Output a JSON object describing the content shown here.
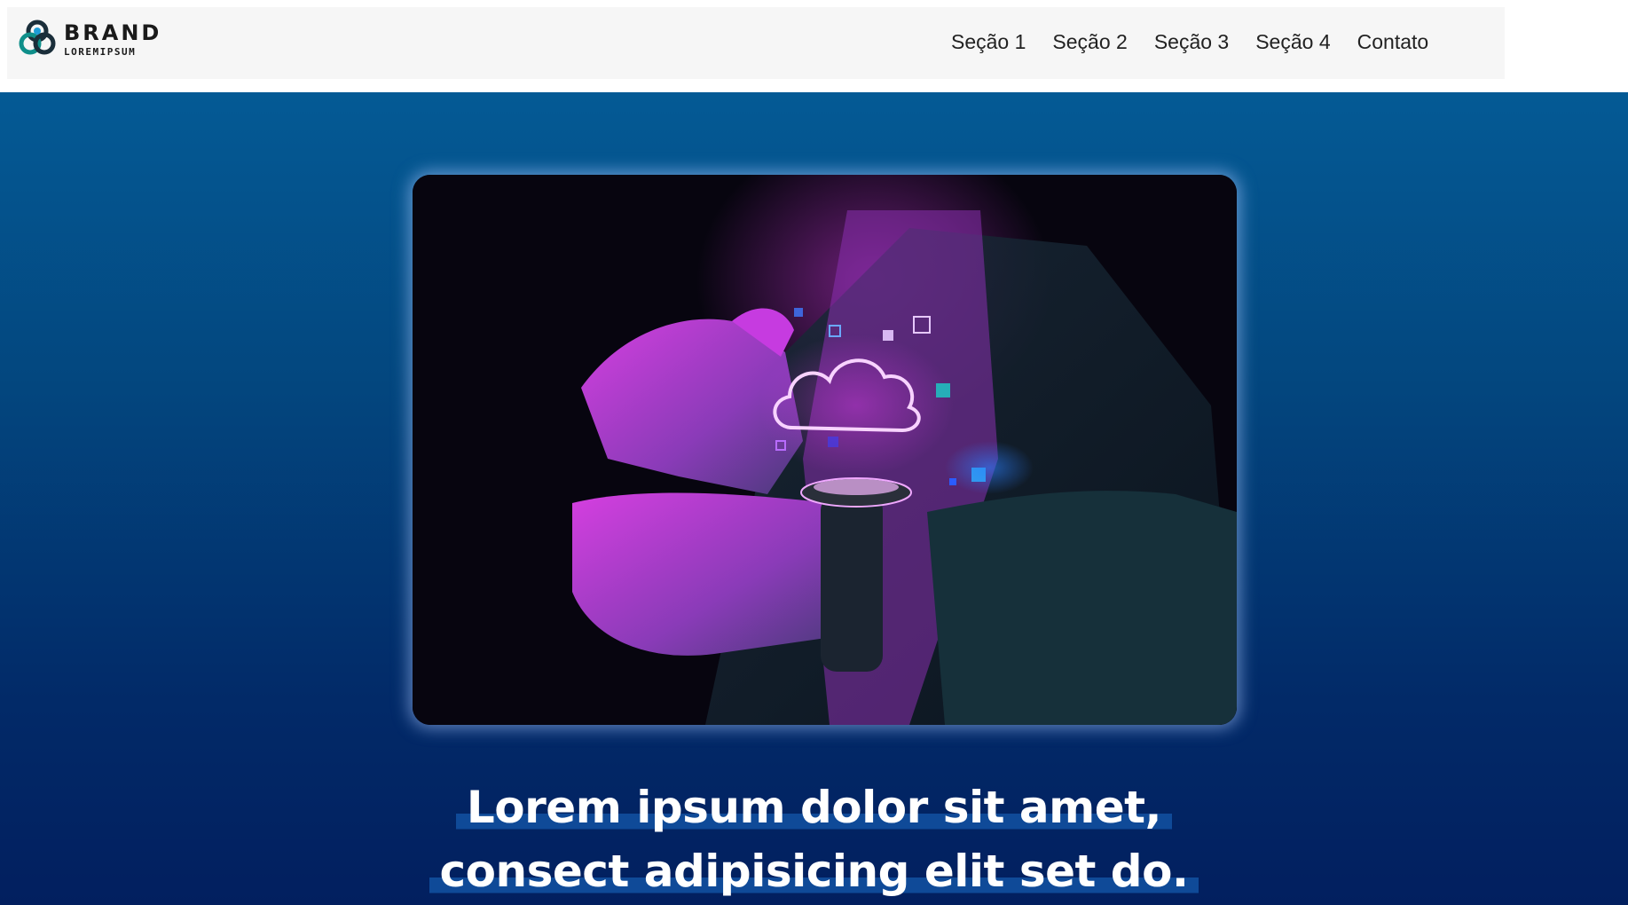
{
  "brand": {
    "name": "BRAND",
    "tagline": "LOREMIPSUM",
    "logo_icon": "interlocking-rings-logo"
  },
  "nav": {
    "items": [
      {
        "label": "Seção 1"
      },
      {
        "label": "Seção 2"
      },
      {
        "label": "Seção 3"
      },
      {
        "label": "Seção 4"
      },
      {
        "label": "Contato"
      }
    ]
  },
  "hero": {
    "image_icon": "smartwatch-cloud-hologram-photo",
    "headline_line1": "Lorem ipsum dolor sit amet,",
    "headline_line2": "consect adipisicing elit set do."
  },
  "colors": {
    "header_bg": "#f6f6f6",
    "hero_top": "#045a95",
    "hero_bottom": "#021f5f",
    "highlight": "#0f4a98",
    "neon_pink": "#e23cf0"
  }
}
